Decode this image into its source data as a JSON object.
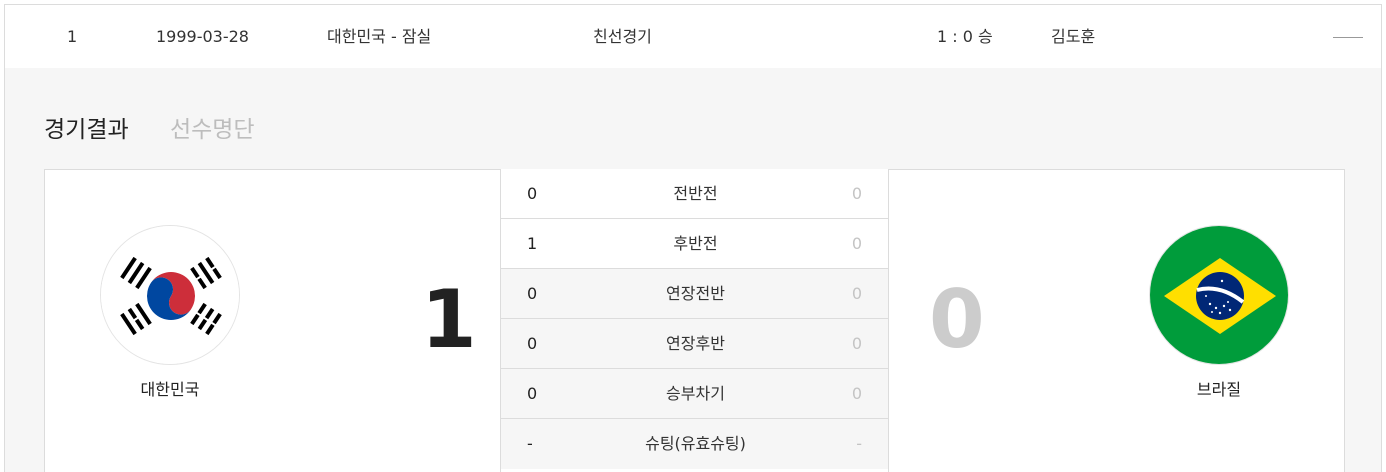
{
  "match_row": {
    "no": "1",
    "date": "1999-03-28",
    "venue": "대한민국 - 잠실",
    "type": "친선경기",
    "result": "1 : 0 승",
    "coach": "김도훈"
  },
  "tabs": [
    {
      "label": "경기결과",
      "active": true
    },
    {
      "label": "선수명단",
      "active": false
    }
  ],
  "home": {
    "name": "대한민국",
    "score": "1",
    "flag": "korea-flag-icon"
  },
  "away": {
    "name": "브라질",
    "score": "0",
    "flag": "brazil-flag-icon"
  },
  "periods": [
    {
      "label": "전반전",
      "home": "0",
      "away": "0"
    },
    {
      "label": "후반전",
      "home": "1",
      "away": "0"
    },
    {
      "label": "연장전반",
      "home": "0",
      "away": "0"
    },
    {
      "label": "연장후반",
      "home": "0",
      "away": "0"
    },
    {
      "label": "승부차기",
      "home": "0",
      "away": "0"
    },
    {
      "label": "슈팅(유효슈팅)",
      "home": "-",
      "away": "-"
    }
  ],
  "colors": {
    "panel_bg": "#f6f6f6",
    "border": "#dcdcdc",
    "muted": "#cccccc",
    "korea_red": "#cd2e3a",
    "korea_blue": "#0047a0",
    "brazil_green": "#009c3b",
    "brazil_yellow": "#ffdf00",
    "brazil_blue": "#002776"
  }
}
